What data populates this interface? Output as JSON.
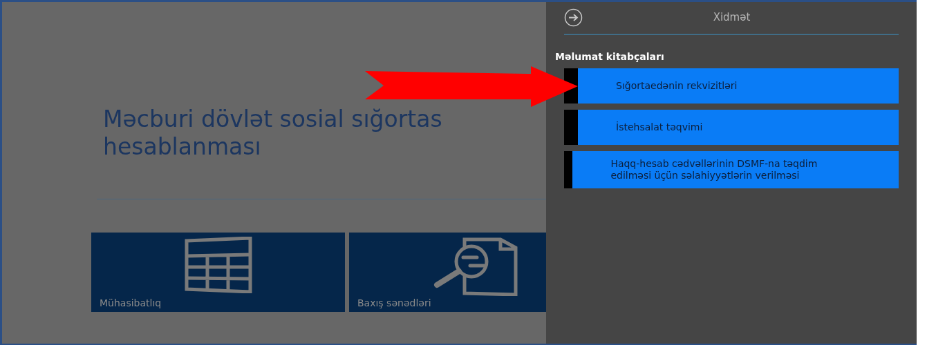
{
  "main": {
    "title_lines": [
      "Məcburi dövlət sosial sığortas",
      "hesablanması"
    ],
    "tiles": [
      {
        "kind": "calculator",
        "label": "Mühasibatlıq"
      },
      {
        "kind": "document-search",
        "label": "Baxış sənədləri"
      }
    ]
  },
  "panel": {
    "title": "Xidmət",
    "section": "Məlumat kitabçaları",
    "items": [
      {
        "label": "Sığortaedənin rekvizitləri"
      },
      {
        "label": "İstehsalat təqvimi"
      },
      {
        "label": "Haqq-hesab cədvəllərinin DSMF-na təqdim edilməsi üçün səlahiyyətlərin verilməsi"
      }
    ]
  }
}
